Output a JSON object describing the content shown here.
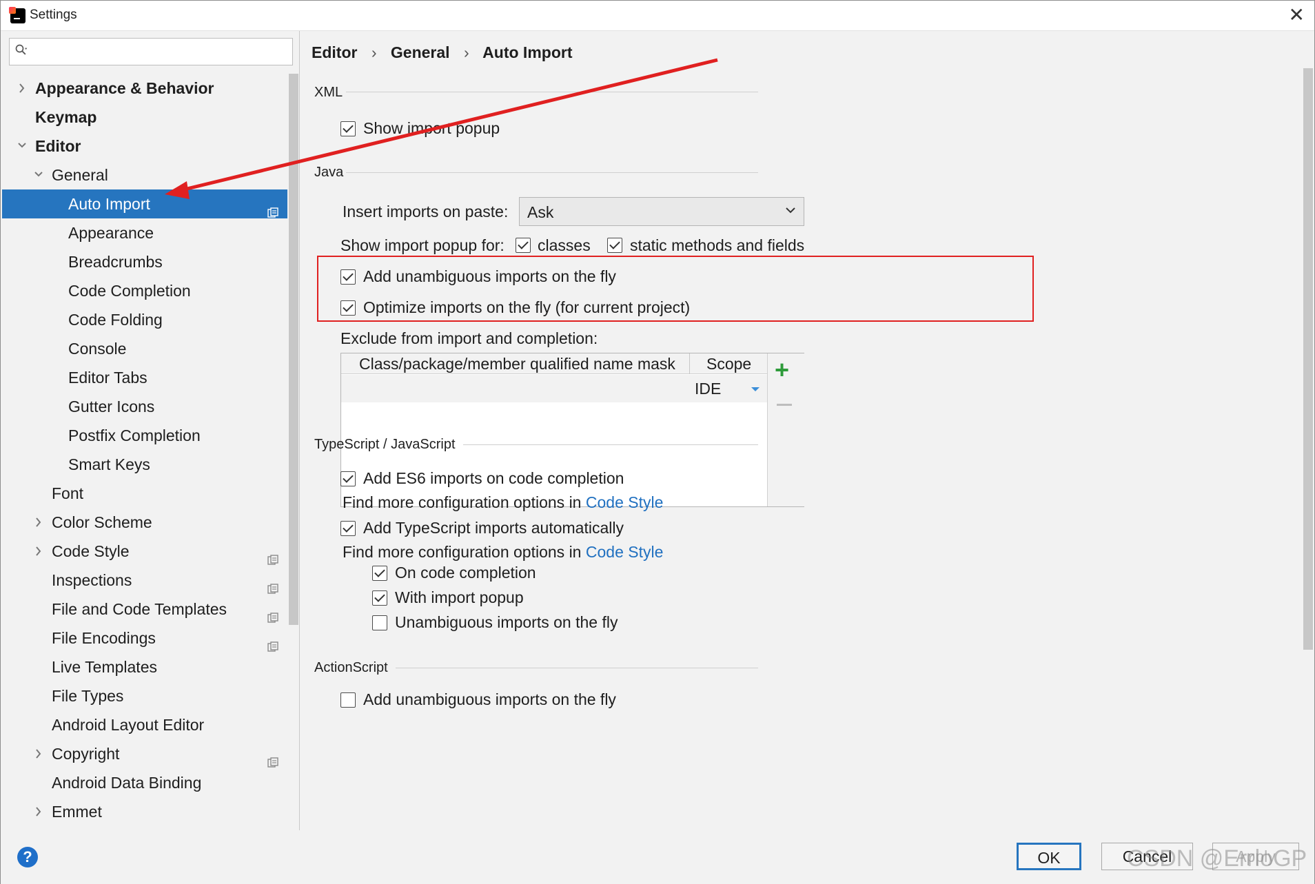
{
  "window": {
    "title": "Settings",
    "close_symbol": "✕"
  },
  "sidebar": {
    "search_placeholder": "",
    "items": [
      {
        "label": "Appearance & Behavior",
        "level": 0,
        "expander": "collapsed",
        "bold": true
      },
      {
        "label": "Keymap",
        "level": 0,
        "expander": "none",
        "bold": true
      },
      {
        "label": "Editor",
        "level": 0,
        "expander": "expanded",
        "bold": true
      },
      {
        "label": "General",
        "level": 1,
        "expander": "expanded"
      },
      {
        "label": "Auto Import",
        "level": 2,
        "expander": "none",
        "selected": true,
        "project_icon": true
      },
      {
        "label": "Appearance",
        "level": 2,
        "expander": "none"
      },
      {
        "label": "Breadcrumbs",
        "level": 2,
        "expander": "none"
      },
      {
        "label": "Code Completion",
        "level": 2,
        "expander": "none"
      },
      {
        "label": "Code Folding",
        "level": 2,
        "expander": "none"
      },
      {
        "label": "Console",
        "level": 2,
        "expander": "none"
      },
      {
        "label": "Editor Tabs",
        "level": 2,
        "expander": "none"
      },
      {
        "label": "Gutter Icons",
        "level": 2,
        "expander": "none"
      },
      {
        "label": "Postfix Completion",
        "level": 2,
        "expander": "none"
      },
      {
        "label": "Smart Keys",
        "level": 2,
        "expander": "none"
      },
      {
        "label": "Font",
        "level": 1,
        "expander": "none"
      },
      {
        "label": "Color Scheme",
        "level": 1,
        "expander": "collapsed"
      },
      {
        "label": "Code Style",
        "level": 1,
        "expander": "collapsed",
        "project_icon": true
      },
      {
        "label": "Inspections",
        "level": 1,
        "expander": "none",
        "project_icon": true
      },
      {
        "label": "File and Code Templates",
        "level": 1,
        "expander": "none",
        "project_icon": true
      },
      {
        "label": "File Encodings",
        "level": 1,
        "expander": "none",
        "project_icon": true
      },
      {
        "label": "Live Templates",
        "level": 1,
        "expander": "none"
      },
      {
        "label": "File Types",
        "level": 1,
        "expander": "none"
      },
      {
        "label": "Android Layout Editor",
        "level": 1,
        "expander": "none"
      },
      {
        "label": "Copyright",
        "level": 1,
        "expander": "collapsed",
        "project_icon": true
      },
      {
        "label": "Android Data Binding",
        "level": 1,
        "expander": "none"
      },
      {
        "label": "Emmet",
        "level": 1,
        "expander": "collapsed"
      }
    ]
  },
  "breadcrumb": {
    "parts": [
      "Editor",
      "General",
      "Auto Import"
    ],
    "separator": "›"
  },
  "xml": {
    "title": "XML",
    "show_import_popup": {
      "label": "Show import popup",
      "checked": true
    }
  },
  "java": {
    "title": "Java",
    "insert_on_paste_label": "Insert imports on paste:",
    "insert_on_paste_value": "Ask",
    "show_popup_for_label": "Show import popup for:",
    "classes": {
      "label": "classes",
      "checked": true
    },
    "static_methods": {
      "label": "static methods and fields",
      "checked": true
    },
    "add_unambiguous": {
      "label": "Add unambiguous imports on the fly",
      "checked": true
    },
    "optimize": {
      "label": "Optimize imports on the fly (for current project)",
      "checked": true
    },
    "exclude_label": "Exclude from import and completion:",
    "table": {
      "columns": [
        "Class/package/member qualified name mask",
        "Scope"
      ],
      "rows": [
        {
          "mask": "",
          "scope": "IDE"
        }
      ]
    }
  },
  "typescript": {
    "title": "TypeScript / JavaScript",
    "add_es6": {
      "label": "Add ES6 imports on code completion",
      "checked": true
    },
    "find_more_1": "Find more configuration options in",
    "code_style_link_1": "Code Style",
    "add_ts": {
      "label": "Add TypeScript imports automatically",
      "checked": true
    },
    "find_more_2": "Find more configuration options in",
    "code_style_link_2": "Code Style",
    "on_code_completion": {
      "label": "On code completion",
      "checked": true
    },
    "with_import_popup": {
      "label": "With import popup",
      "checked": true
    },
    "unambiguous_on_fly": {
      "label": "Unambiguous imports on the fly",
      "checked": false
    }
  },
  "actionscript": {
    "title": "ActionScript",
    "add_unambiguous": {
      "label": "Add unambiguous imports on the fly",
      "checked": false
    }
  },
  "footer": {
    "help": "?",
    "ok": "OK",
    "cancel": "Cancel",
    "apply": "Apply",
    "watermark": "CSDN @ErrloGP"
  },
  "colors": {
    "selection": "#2675bf",
    "annotation_red": "#e02020",
    "link": "#2070c0",
    "add_green": "#2e9b3a"
  }
}
